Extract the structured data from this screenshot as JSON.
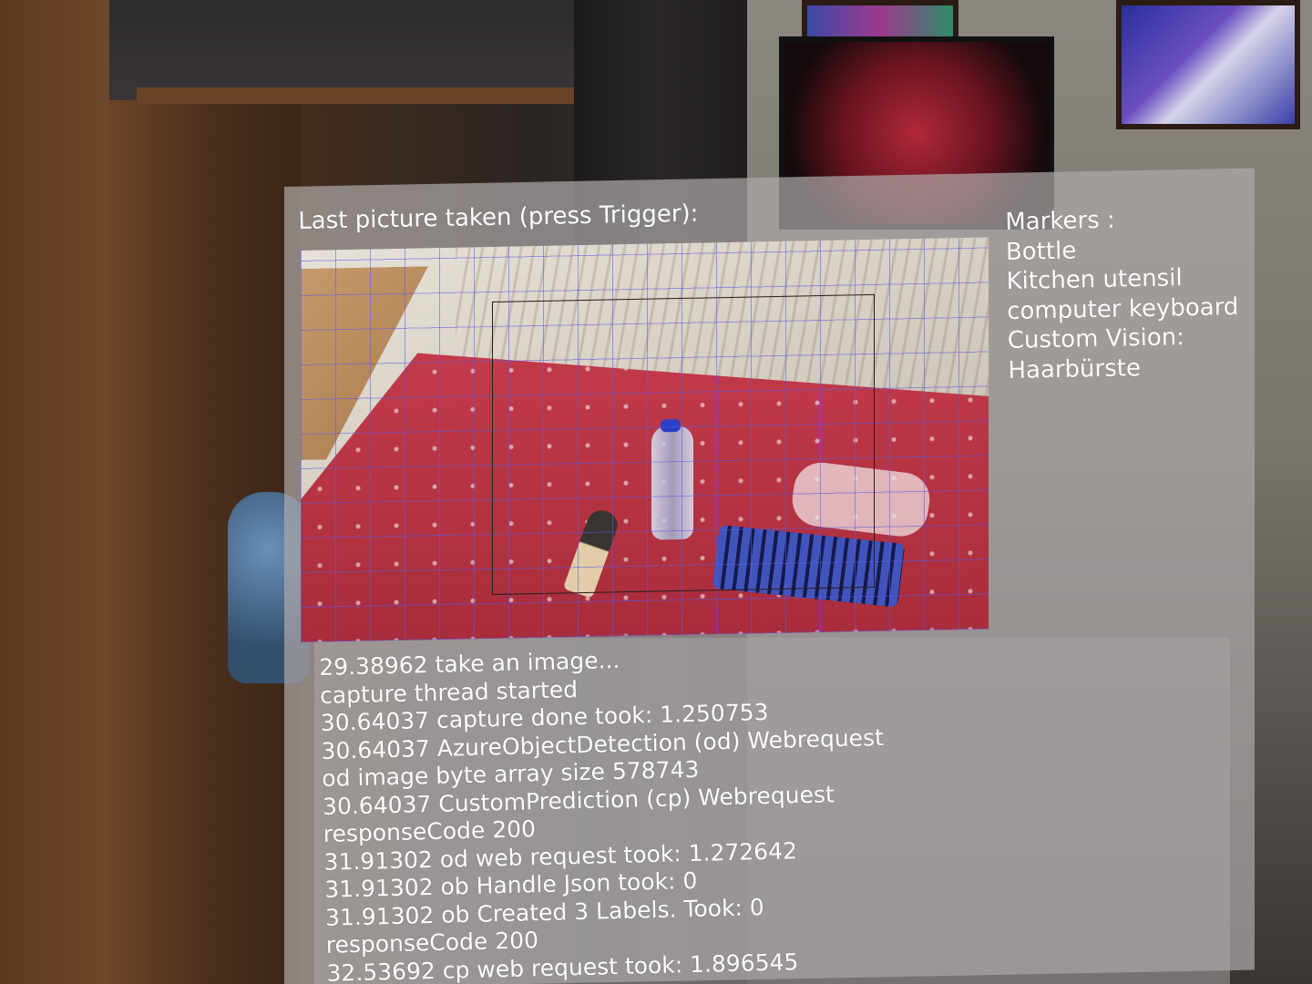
{
  "panel": {
    "title": "Last picture taken (press Trigger):"
  },
  "markers": {
    "heading": "Markers :",
    "items": [
      "Bottle",
      "Kitchen utensil",
      "computer keyboard",
      "Custom Vision:",
      "Haarbürste"
    ]
  },
  "log": {
    "lines": [
      "29.38962 take an image...",
      "capture thread started",
      "30.64037 capture done took: 1.250753",
      "30.64037 AzureObjectDetection (od) Webrequest",
      "od image byte array size 578743",
      "30.64037 CustomPrediction (cp) Webrequest",
      "responseCode 200",
      "31.91302 od web request took: 1.272642",
      "31.91302 ob Handle Json took: 0",
      "31.91302 ob Created 3 Labels. Took: 0",
      "responseCode 200",
      "32.53692 cp web request took: 1.896545"
    ]
  },
  "colors": {
    "panel_bg": "#aca8a8",
    "text": "#ffffff",
    "table_red": "#c23a4a",
    "grid_line": "#5a5ae6"
  }
}
